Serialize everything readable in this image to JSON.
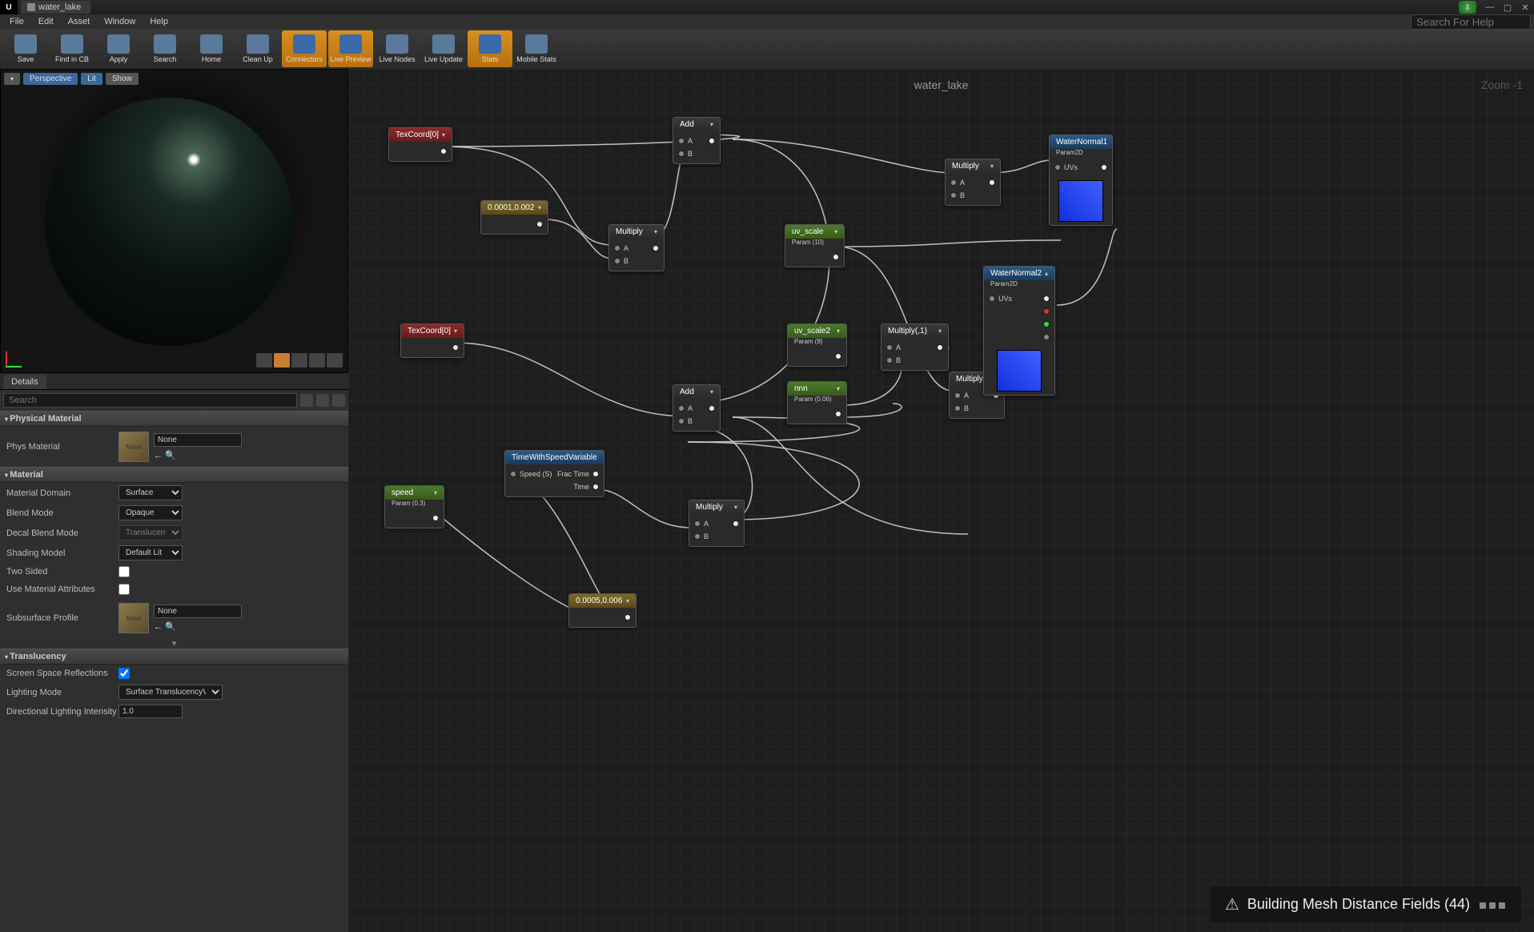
{
  "tab_title": "water_lake",
  "menu": [
    "File",
    "Edit",
    "Asset",
    "Window",
    "Help"
  ],
  "search_help_placeholder": "Search For Help",
  "toolbar": [
    {
      "label": "Save",
      "active": false
    },
    {
      "label": "Find in CB",
      "active": false
    },
    {
      "label": "Apply",
      "active": false
    },
    {
      "label": "Search",
      "active": false
    },
    {
      "label": "Home",
      "active": false
    },
    {
      "label": "Clean Up",
      "active": false
    },
    {
      "label": "Connectors",
      "active": true
    },
    {
      "label": "Live Preview",
      "active": true
    },
    {
      "label": "Live Nodes",
      "active": false
    },
    {
      "label": "Live Update",
      "active": false
    },
    {
      "label": "Stats",
      "active": true
    },
    {
      "label": "Mobile Stats",
      "active": false
    }
  ],
  "viewport": {
    "mode": "Perspective",
    "lit": "Lit",
    "show": "Show"
  },
  "details": {
    "tab": "Details",
    "search_placeholder": "Search",
    "thumb_none": "None",
    "combo_none": "None",
    "cats": {
      "physical": "Physical Material",
      "material": "Material",
      "translucency": "Translucency"
    },
    "props": {
      "phys_material": "Phys Material",
      "material_domain": {
        "label": "Material Domain",
        "value": "Surface"
      },
      "blend_mode": {
        "label": "Blend Mode",
        "value": "Opaque"
      },
      "decal_blend": {
        "label": "Decal Blend Mode",
        "value": "Translucent"
      },
      "shading_model": {
        "label": "Shading Model",
        "value": "Default Lit"
      },
      "two_sided": "Two Sided",
      "use_mat_attr": "Use Material Attributes",
      "subsurface": "Subsurface Profile",
      "ssr": "Screen Space Reflections",
      "lighting_mode": {
        "label": "Lighting Mode",
        "value": "Surface TranslucencyVolume"
      },
      "dir_light": {
        "label": "Directional Lighting Intensity",
        "value": "1.0"
      }
    }
  },
  "graph": {
    "title": "water_lake",
    "zoom": "Zoom -1",
    "pins": {
      "a": "A",
      "b": "B",
      "uvs": "UVs",
      "speed": "Speed (S)",
      "fractime": "Frac Time",
      "time": "Time"
    },
    "nodes": {
      "tex1": "TexCoord[0]",
      "tex2": "TexCoord[0]",
      "const1": "0.0001,0.002",
      "const2": "0.0005,0.006",
      "add1": "Add",
      "add2": "Add",
      "mul1": "Multiply",
      "mul2": "Multiply",
      "mul3": "Multiply",
      "mul4": "Multiply",
      "mulc": {
        "label": "Multiply(,1)"
      },
      "uvs1": {
        "label": "uv_scale",
        "sub": "Param (10)"
      },
      "uvs2": {
        "label": "uv_scale2",
        "sub": "Param (8)"
      },
      "nnn": {
        "label": "nnn",
        "sub": "Param (0.06)"
      },
      "speed": {
        "label": "speed",
        "sub": "Param (0.3)"
      },
      "time": {
        "label": "TimeWithSpeedVariable"
      },
      "wn1": {
        "label": "WaterNormal1",
        "sub": "Param2D"
      },
      "wn2": {
        "label": "WaterNormal2",
        "sub": "Param2D"
      }
    }
  },
  "toast": "Building Mesh Distance Fields (44)"
}
